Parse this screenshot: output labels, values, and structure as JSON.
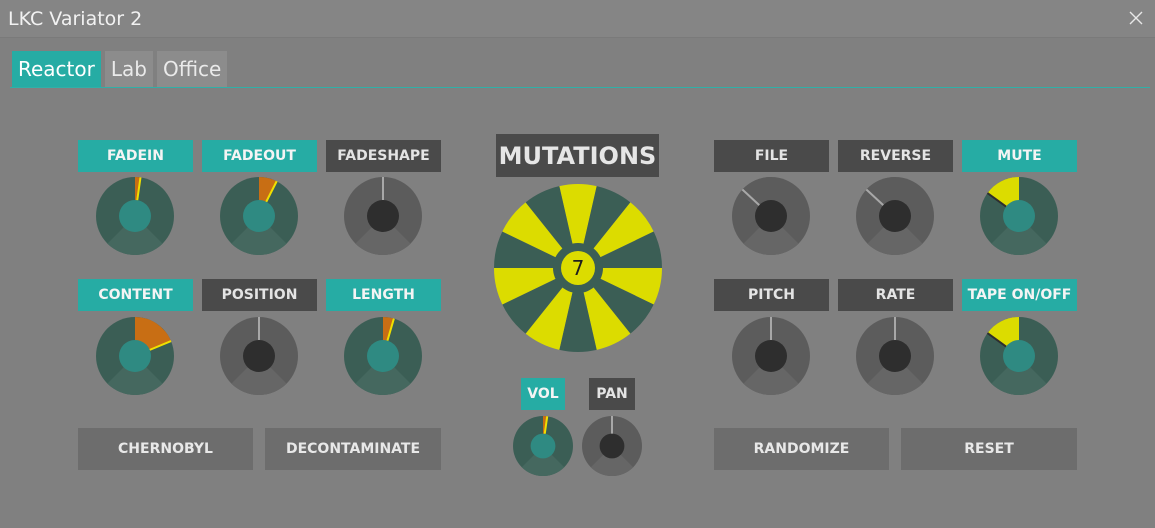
{
  "window": {
    "title": "LKC Variator 2"
  },
  "tabs": [
    {
      "label": "Reactor",
      "active": true
    },
    {
      "label": "Lab",
      "active": false
    },
    {
      "label": "Office",
      "active": false
    }
  ],
  "colors": {
    "teal": "#26aca4",
    "orange": "#c86e14",
    "yellow": "#dcdc00",
    "dark_teal": "#3b5e55",
    "knob_gray": "#5c5c5c"
  },
  "knobs": [
    {
      "id": "fadein",
      "label": "FADEIN",
      "active": true,
      "value": 0.06
    },
    {
      "id": "fadeout",
      "label": "FADEOUT",
      "active": true,
      "value": 0.2
    },
    {
      "id": "fadeshape",
      "label": "FADESHAPE",
      "active": false,
      "value": 0.0
    },
    {
      "id": "content",
      "label": "CONTENT",
      "active": true,
      "value": 0.5
    },
    {
      "id": "position",
      "label": "POSITION",
      "active": false,
      "value": 0.0
    },
    {
      "id": "length",
      "label": "LENGTH",
      "active": true,
      "value": 0.12
    },
    {
      "id": "file",
      "label": "FILE",
      "active": false,
      "value": -0.35
    },
    {
      "id": "reverse",
      "label": "REVERSE",
      "active": false,
      "value": -0.35
    },
    {
      "id": "mute",
      "label": "MUTE",
      "active": true,
      "value": -0.4
    },
    {
      "id": "pitch",
      "label": "PITCH",
      "active": false,
      "value": 0.0
    },
    {
      "id": "rate",
      "label": "RATE",
      "active": false,
      "value": 0.0
    },
    {
      "id": "tape",
      "label": "TAPE ON/OFF",
      "active": true,
      "value": -0.4
    },
    {
      "id": "vol",
      "label": "VOL",
      "active": true,
      "value": 0.06
    },
    {
      "id": "pan",
      "label": "PAN",
      "active": false,
      "value": 0.0
    }
  ],
  "mutations": {
    "title": "MUTATIONS",
    "value": "7",
    "segments": 14
  },
  "buttons": {
    "chernobyl": "CHERNOBYL",
    "decontaminate": "DECONTAMINATE",
    "randomize": "RANDOMIZE",
    "reset": "RESET"
  }
}
